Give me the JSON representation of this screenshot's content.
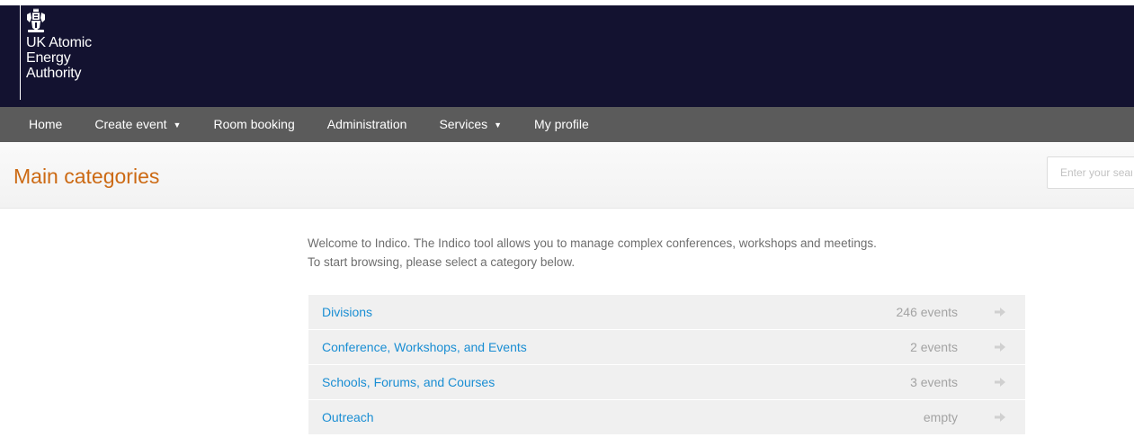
{
  "logo": {
    "lines": [
      "UK Atomic",
      "Energy",
      "Authority"
    ]
  },
  "nav": {
    "items": [
      {
        "label": "Home",
        "dropdown": false
      },
      {
        "label": "Create event",
        "dropdown": true
      },
      {
        "label": "Room booking",
        "dropdown": false
      },
      {
        "label": "Administration",
        "dropdown": false
      },
      {
        "label": "Services",
        "dropdown": true
      },
      {
        "label": "My profile",
        "dropdown": false
      }
    ]
  },
  "page": {
    "title": "Main categories"
  },
  "search": {
    "placeholder": "Enter your search term"
  },
  "welcome": {
    "line1": "Welcome to Indico. The Indico tool allows you to manage complex conferences, workshops and meetings.",
    "line2": "To start browsing, please select a category below."
  },
  "categories": [
    {
      "name": "Divisions",
      "count": "246 events"
    },
    {
      "name": "Conference, Workshops, and Events",
      "count": "2 events"
    },
    {
      "name": "Schools, Forums, and Courses",
      "count": "3 events"
    },
    {
      "name": "Outreach",
      "count": "empty"
    }
  ],
  "colors": {
    "header_bg": "#131230",
    "nav_bg": "#5b5b5b",
    "title": "#cc6a14",
    "link": "#1a8ed3"
  }
}
